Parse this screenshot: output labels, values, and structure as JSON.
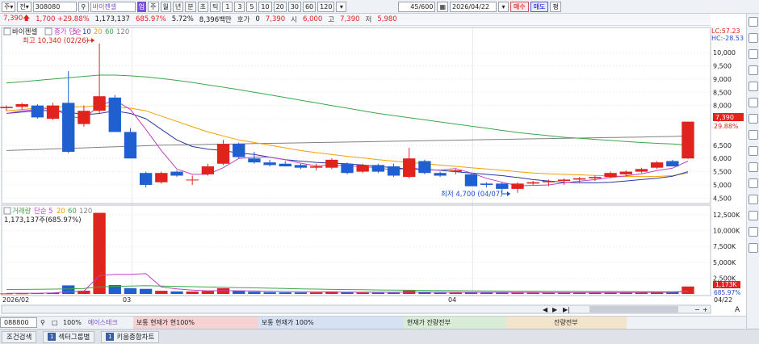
{
  "toolbar": {
    "period_select": "주",
    "market_select": "전",
    "code": "308080",
    "stock_name": "바이젠셀",
    "tag": "업",
    "periods": [
      "주",
      "월",
      "년",
      "분",
      "초",
      "틱"
    ],
    "intervals": [
      "1",
      "3",
      "5",
      "10",
      "20",
      "30",
      "60",
      "120"
    ],
    "page_count": "45/600",
    "date": "2026/04/22",
    "buy": "매수",
    "sell": "매도",
    "eval": "평"
  },
  "quote": {
    "price": "7,390",
    "change": "1,700 +29.88%",
    "volume": "1,173,137",
    "volume_ratio": "685.97%",
    "turnover": "5.72%",
    "amount": "8,396백만",
    "ask_label": "호가",
    "ask_value": "0",
    "current": "7,390",
    "open_label": "시",
    "open_value": "6,000",
    "high_label": "고",
    "high_value": "7,390",
    "low_label": "저",
    "low_value": "5,980"
  },
  "price_panel": {
    "name_label": "바이젠셀",
    "legend": [
      "종가 단순",
      "5",
      "10",
      "20",
      "60",
      "120"
    ],
    "max_label": "최고 10,340 (02/26)",
    "min_label": "최저 4,700 (04/07)",
    "lc": "LC:57.23",
    "hc": "HC:-28.53",
    "price_tag": "7,390",
    "pct_tag": "29.88%",
    "y_ticks": [
      "10,000",
      "9,500",
      "9,000",
      "8,500",
      "8,000",
      "7,500",
      "6,500",
      "6,000",
      "5,500",
      "5,000",
      "4,500"
    ]
  },
  "volume_panel": {
    "legend": [
      "거래량",
      "단순",
      "5",
      "20",
      "60",
      "120"
    ],
    "info": "1,173,137주(685.97%)",
    "tag_value": "1,173K",
    "tag_pct": "685.97%",
    "y_ticks": [
      "12,500K",
      "10,000K",
      "7,500K",
      "5,000K",
      "2,500K"
    ]
  },
  "x_axis": {
    "labels": [
      "2026/02",
      "03",
      "04"
    ],
    "right_label": "04/22"
  },
  "bottom_bar": {
    "code": "088800",
    "zoom": "100%",
    "name": "에이스테크",
    "cells": [
      "보통 현재가 현100%",
      "보통 현재가 100%",
      "현재가 잔량전부",
      "잔량전부"
    ]
  },
  "tabs": [
    "조건검색",
    "섹터그룹별",
    "키움종합차트"
  ],
  "colors": {
    "up": "#e0231c",
    "down": "#1f5fd0",
    "ma5": "#c040c0",
    "ma10": "#2a3aa0",
    "ma20": "#f0a000",
    "ma60": "#3aa84a",
    "ma120": "#808080"
  },
  "chart_data": {
    "type": "candlestick",
    "candles": [
      {
        "o": 7900,
        "h": 8000,
        "l": 7800,
        "c": 7950
      },
      {
        "o": 7950,
        "h": 8100,
        "l": 7850,
        "c": 8050
      },
      {
        "o": 8000,
        "h": 8050,
        "l": 7500,
        "c": 7550
      },
      {
        "o": 7500,
        "h": 8100,
        "l": 7450,
        "c": 8000
      },
      {
        "o": 8100,
        "h": 9300,
        "l": 6200,
        "c": 6250
      },
      {
        "o": 7300,
        "h": 8000,
        "l": 7200,
        "c": 7800
      },
      {
        "o": 7800,
        "h": 10340,
        "l": 7700,
        "c": 8350
      },
      {
        "o": 8300,
        "h": 8400,
        "l": 7000,
        "c": 7000
      },
      {
        "o": 7000,
        "h": 7150,
        "l": 6000,
        "c": 6000
      },
      {
        "o": 5450,
        "h": 5500,
        "l": 4900,
        "c": 5000
      },
      {
        "o": 5100,
        "h": 5500,
        "l": 5050,
        "c": 5450
      },
      {
        "o": 5500,
        "h": 5550,
        "l": 5300,
        "c": 5350
      },
      {
        "o": 5200,
        "h": 5350,
        "l": 5000,
        "c": 5200
      },
      {
        "o": 5400,
        "h": 5800,
        "l": 5350,
        "c": 5700
      },
      {
        "o": 5800,
        "h": 6700,
        "l": 5750,
        "c": 6550
      },
      {
        "o": 6550,
        "h": 6600,
        "l": 6000,
        "c": 6050
      },
      {
        "o": 6000,
        "h": 6250,
        "l": 5800,
        "c": 5850
      },
      {
        "o": 5850,
        "h": 5950,
        "l": 5700,
        "c": 5750
      },
      {
        "o": 5800,
        "h": 5900,
        "l": 5700,
        "c": 5700
      },
      {
        "o": 5750,
        "h": 5800,
        "l": 5600,
        "c": 5650
      },
      {
        "o": 5650,
        "h": 5800,
        "l": 5550,
        "c": 5700
      },
      {
        "o": 5650,
        "h": 6000,
        "l": 5600,
        "c": 5950
      },
      {
        "o": 5800,
        "h": 5850,
        "l": 5400,
        "c": 5450
      },
      {
        "o": 5500,
        "h": 5800,
        "l": 5450,
        "c": 5750
      },
      {
        "o": 5750,
        "h": 5800,
        "l": 5450,
        "c": 5500
      },
      {
        "o": 5700,
        "h": 5800,
        "l": 5300,
        "c": 5350
      },
      {
        "o": 5300,
        "h": 6400,
        "l": 5250,
        "c": 6000
      },
      {
        "o": 5900,
        "h": 5950,
        "l": 5400,
        "c": 5450
      },
      {
        "o": 5450,
        "h": 5500,
        "l": 5300,
        "c": 5350
      },
      {
        "o": 5500,
        "h": 5600,
        "l": 5400,
        "c": 5550
      },
      {
        "o": 5400,
        "h": 5450,
        "l": 4950,
        "c": 4950
      },
      {
        "o": 5050,
        "h": 5100,
        "l": 4900,
        "c": 5000
      },
      {
        "o": 5050,
        "h": 5100,
        "l": 4700,
        "c": 4850
      },
      {
        "o": 4850,
        "h": 5100,
        "l": 4700,
        "c": 5050
      },
      {
        "o": 5050,
        "h": 5150,
        "l": 5000,
        "c": 5100
      },
      {
        "o": 5100,
        "h": 5200,
        "l": 4950,
        "c": 5150
      },
      {
        "o": 5150,
        "h": 5250,
        "l": 5000,
        "c": 5200
      },
      {
        "o": 5200,
        "h": 5300,
        "l": 5100,
        "c": 5250
      },
      {
        "o": 5250,
        "h": 5350,
        "l": 5150,
        "c": 5300
      },
      {
        "o": 5300,
        "h": 5500,
        "l": 5250,
        "c": 5450
      },
      {
        "o": 5400,
        "h": 5550,
        "l": 5350,
        "c": 5500
      },
      {
        "o": 5500,
        "h": 5650,
        "l": 5450,
        "c": 5600
      },
      {
        "o": 5650,
        "h": 5900,
        "l": 5600,
        "c": 5850
      },
      {
        "o": 5900,
        "h": 5950,
        "l": 5700,
        "c": 5700
      },
      {
        "o": 6000,
        "h": 7390,
        "l": 5980,
        "c": 7390
      }
    ],
    "volume_k": [
      80,
      90,
      120,
      200,
      1350,
      520,
      12800,
      1400,
      900,
      800,
      500,
      400,
      380,
      450,
      900,
      520,
      350,
      280,
      250,
      240,
      240,
      400,
      260,
      230,
      210,
      200,
      540,
      250,
      200,
      200,
      260,
      250,
      270,
      200,
      210,
      200,
      190,
      210,
      220,
      250,
      240,
      260,
      300,
      260,
      1173
    ],
    "ma": {
      "ma5": [
        7700,
        7800,
        7850,
        7900,
        7600,
        7500,
        8000,
        8200,
        7850,
        7100,
        6300,
        5600,
        5400,
        5400,
        5650,
        6000,
        6050,
        6050,
        5950,
        5820,
        5720,
        5760,
        5720,
        5690,
        5650,
        5550,
        5650,
        5580,
        5560,
        5620,
        5450,
        5250,
        5100,
        4970,
        4980,
        5000,
        5080,
        5140,
        5200,
        5280,
        5340,
        5420,
        5540,
        5630,
        5900
      ],
      "ma10": [
        7700,
        7750,
        7800,
        7820,
        7750,
        7650,
        7700,
        7800,
        7700,
        7500,
        7100,
        6700,
        6450,
        6350,
        6300,
        6200,
        6150,
        6050,
        5950,
        5900,
        5850,
        5820,
        5800,
        5750,
        5700,
        5650,
        5600,
        5580,
        5550,
        5500,
        5450,
        5400,
        5350,
        5280,
        5200,
        5150,
        5100,
        5080,
        5080,
        5100,
        5150,
        5200,
        5250,
        5330,
        5500
      ],
      "ma20": [
        7800,
        7850,
        7900,
        7950,
        7950,
        7950,
        8000,
        7950,
        7900,
        7800,
        7600,
        7400,
        7200,
        7000,
        6850,
        6700,
        6600,
        6500,
        6400,
        6300,
        6220,
        6150,
        6080,
        6020,
        5950,
        5900,
        5850,
        5800,
        5750,
        5700,
        5650,
        5600,
        5550,
        5500,
        5450,
        5420,
        5400,
        5380,
        5360,
        5340,
        5320,
        5310,
        5320,
        5350,
        5450
      ],
      "ma60": [
        8850,
        8900,
        8950,
        9000,
        9050,
        9100,
        9150,
        9150,
        9120,
        9080,
        9020,
        8950,
        8870,
        8780,
        8690,
        8600,
        8500,
        8400,
        8300,
        8200,
        8100,
        8000,
        7900,
        7800,
        7700,
        7620,
        7540,
        7460,
        7380,
        7300,
        7220,
        7140,
        7060,
        6980,
        6920,
        6860,
        6800,
        6760,
        6720,
        6680,
        6640,
        6600,
        6570,
        6550,
        6500
      ],
      "ma120": [
        6300,
        6320,
        6340,
        6360,
        6380,
        6400,
        6420,
        6440,
        6460,
        6480,
        6500,
        6510,
        6520,
        6530,
        6540,
        6550,
        6560,
        6570,
        6580,
        6590,
        6600,
        6610,
        6620,
        6630,
        6640,
        6650,
        6660,
        6670,
        6680,
        6690,
        6700,
        6710,
        6720,
        6730,
        6740,
        6750,
        6760,
        6770,
        6780,
        6790,
        6800,
        6810,
        6820,
        6830,
        6850
      ]
    },
    "vol_ma5_k": [
      100,
      110,
      120,
      150,
      350,
      450,
      2900,
      3100,
      3100,
      3200,
      1100,
      800,
      600,
      500,
      520,
      500,
      470,
      430,
      400,
      370,
      330,
      300,
      290,
      280,
      270,
      270,
      300,
      290,
      280,
      270,
      260,
      260,
      250,
      240,
      240,
      230,
      220,
      220,
      220,
      230,
      230,
      240,
      250,
      260,
      450
    ],
    "vol_ma20_k": [
      700,
      720,
      740,
      760,
      800,
      850,
      1100,
      1200,
      1250,
      1300,
      1250,
      1200,
      1150,
      1100,
      1050,
      1000,
      950,
      900,
      850,
      800,
      760,
      720,
      690,
      660,
      630,
      600,
      580,
      560,
      540,
      520,
      500,
      480,
      460,
      450,
      440,
      430,
      420,
      410,
      400,
      390,
      380,
      370,
      360,
      350,
      400
    ],
    "ylim_price": [
      4500,
      10340
    ],
    "ylim_volume_k": [
      0,
      13000
    ]
  }
}
